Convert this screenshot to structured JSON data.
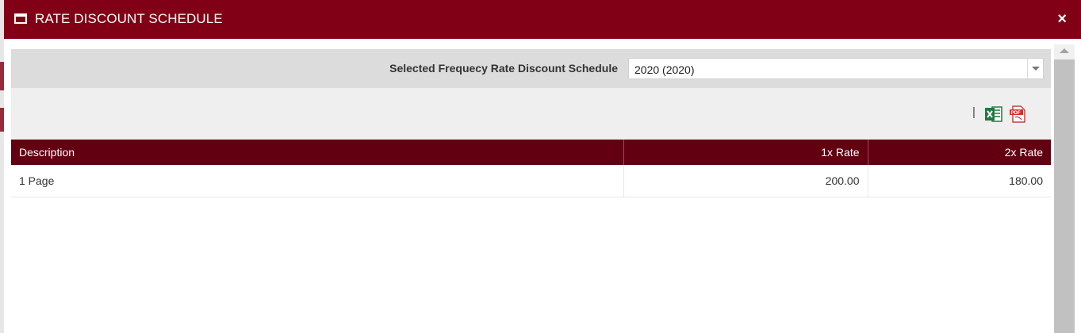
{
  "modal": {
    "title": "RATE DISCOUNT SCHEDULE",
    "close_symbol": "×",
    "title_icon": "window-icon",
    "colors": {
      "titlebar": "#820016",
      "table_header": "#620012"
    }
  },
  "filter": {
    "label": "Selected Frequecy Rate Discount Schedule",
    "selected_value": "2020 (2020)"
  },
  "toolbar": {
    "separator": "|",
    "export_excel_icon": "excel-icon",
    "export_pdf_icon": "pdf-icon"
  },
  "table": {
    "headers": [
      "Description",
      "1x Rate",
      "2x Rate"
    ],
    "rows": [
      [
        "1 Page",
        "200.00",
        "180.00"
      ]
    ]
  }
}
